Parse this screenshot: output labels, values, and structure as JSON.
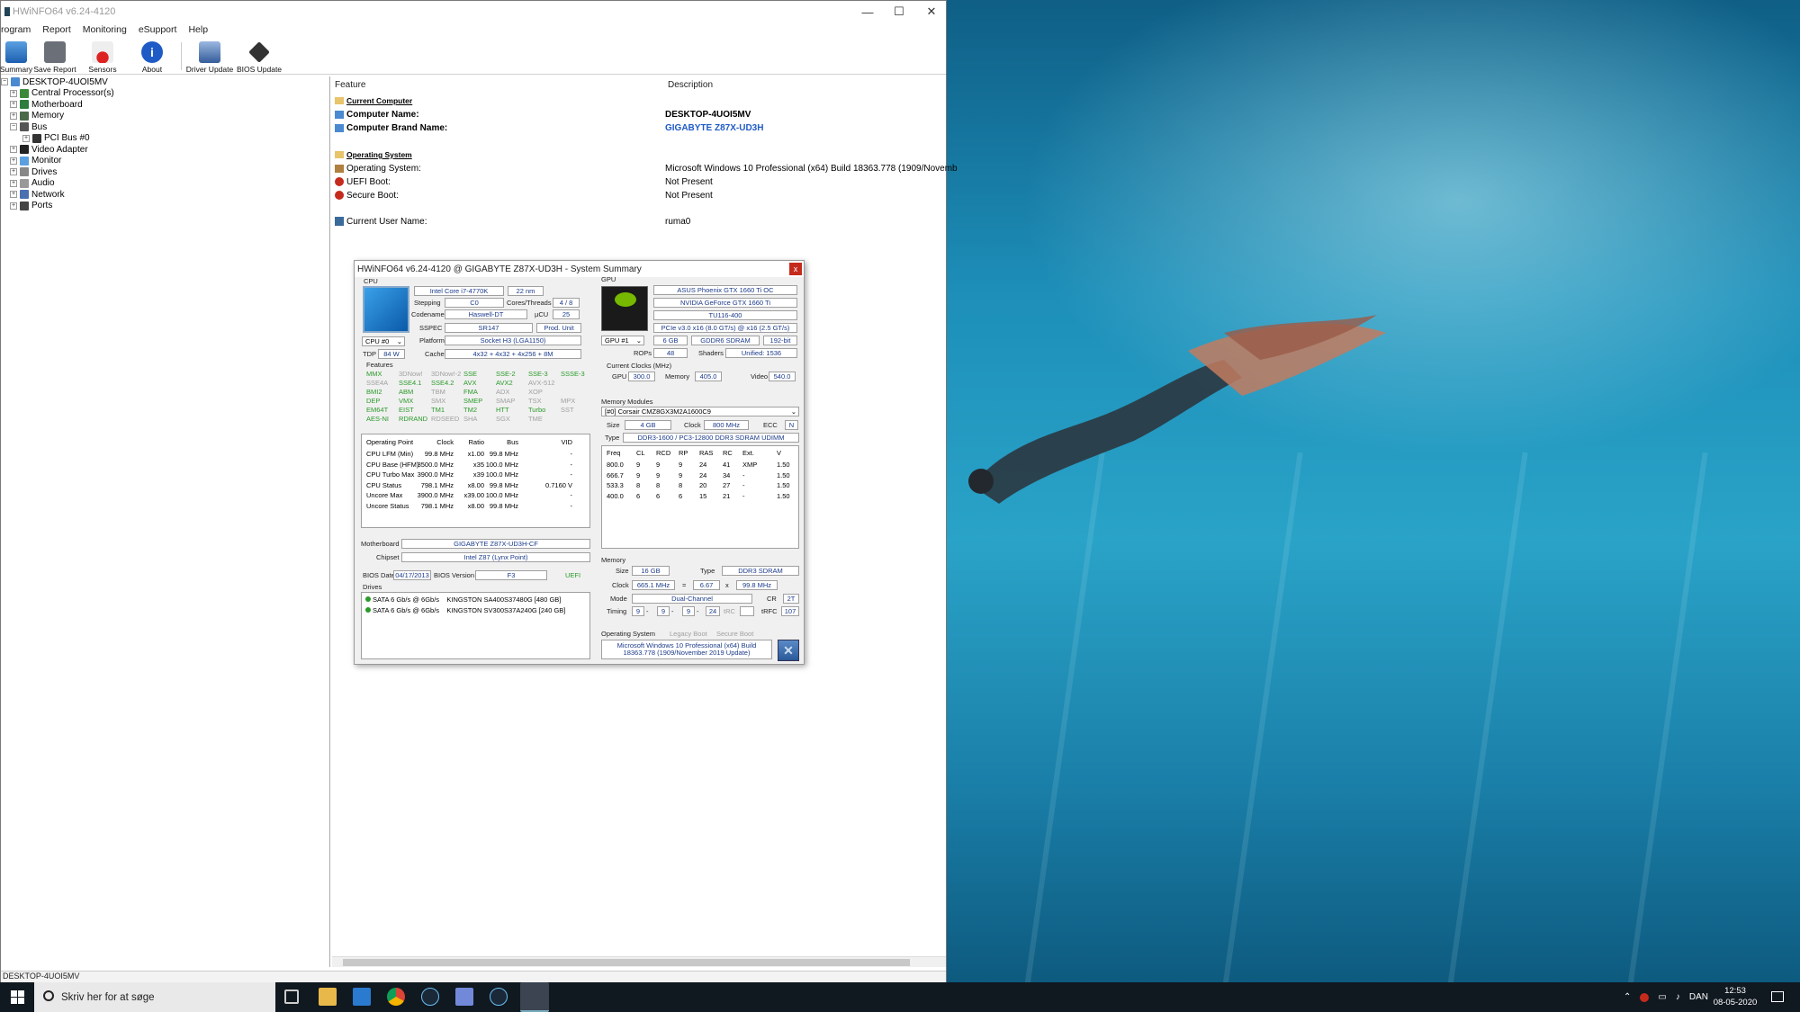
{
  "window": {
    "title": "HWiNFO64 v6.24-4120",
    "controls": {
      "minimize": "—",
      "maximize": "☐",
      "close": "✕"
    }
  },
  "menu": [
    "rogram",
    "Report",
    "Monitoring",
    "eSupport",
    "Help"
  ],
  "toolbar": [
    "Summary",
    "Save Report",
    "Sensors",
    "About",
    "Driver Update",
    "BIOS Update"
  ],
  "tree": {
    "root": "DESKTOP-4UOI5MV",
    "items": [
      "Central Processor(s)",
      "Motherboard",
      "Memory",
      "Bus",
      "PCI Bus #0",
      "Video Adapter",
      "Monitor",
      "Drives",
      "Audio",
      "Network",
      "Ports"
    ]
  },
  "detail": {
    "col_feature": "Feature",
    "col_description": "Description",
    "current_computer": "Current Computer",
    "computer_name_label": "Computer Name:",
    "computer_name": "DESKTOP-4UOI5MV",
    "brand_label": "Computer Brand Name:",
    "brand": "GIGABYTE Z87X-UD3H",
    "operating_system": "Operating System",
    "os_label": "Operating System:",
    "os": "Microsoft Windows 10 Professional (x64) Build 18363.778 (1909/Novemb",
    "uefi_label": "UEFI Boot:",
    "uefi": "Not Present",
    "secure_label": "Secure Boot:",
    "secure": "Not Present",
    "user_label": "Current User Name:",
    "user": "ruma0"
  },
  "status": "DESKTOP-4UOI5MV",
  "summary": {
    "title": "HWiNFO64 v6.24-4120 @ GIGABYTE Z87X-UD3H - System Summary",
    "close": "x",
    "cpu_label": "CPU",
    "cpu_name": "Intel Core i7-4770K",
    "cpu_nm": "22 nm",
    "stepping_label": "Stepping",
    "stepping": "C0",
    "cores_label": "Cores/Threads",
    "cores": "4 / 8",
    "codename_label": "Codename",
    "codename": "Haswell-DT",
    "ucu_label": "µCU",
    "ucu": "25",
    "sspec_label": "SSPEC",
    "sspec": "SR147",
    "prod": "Prod. Unit",
    "cpu_sel": "CPU #0",
    "platform_label": "Platform",
    "platform": "Socket H3 (LGA1150)",
    "tdp_label": "TDP",
    "tdp": "84 W",
    "cache_label": "Cache",
    "cache": "4x32 + 4x32 + 4x256 + 8M",
    "features_label": "Features",
    "features": [
      [
        "MMX",
        "3DNow!",
        "3DNow!-2",
        "SSE",
        "SSE-2",
        "SSE-3",
        "SSSE-3"
      ],
      [
        "SSE4A",
        "SSE4.1",
        "SSE4.2",
        "AVX",
        "AVX2",
        "AVX-512",
        ""
      ],
      [
        "BMI2",
        "ABM",
        "TBM",
        "FMA",
        "ADX",
        "XOP",
        ""
      ],
      [
        "DEP",
        "VMX",
        "SMX",
        "SMEP",
        "SMAP",
        "TSX",
        "MPX"
      ],
      [
        "EM64T",
        "EIST",
        "TM1",
        "TM2",
        "HTT",
        "Turbo",
        "SST"
      ],
      [
        "AES-NI",
        "RDRAND",
        "RDSEED",
        "SHA",
        "SGX",
        "TME",
        ""
      ]
    ],
    "op_headers": [
      "Operating Point",
      "Clock",
      "Ratio",
      "Bus",
      "VID"
    ],
    "op_rows": [
      [
        "CPU LFM (Min)",
        "99.8 MHz",
        "x1.00",
        "99.8 MHz",
        "-"
      ],
      [
        "CPU Base (HFM)",
        "3500.0 MHz",
        "x35",
        "100.0 MHz",
        "-"
      ],
      [
        "CPU Turbo Max",
        "3900.0 MHz",
        "x39",
        "100.0 MHz",
        "-"
      ],
      [
        "CPU Status",
        "798.1 MHz",
        "x8.00",
        "99.8 MHz",
        "0.7160 V"
      ],
      [
        "Uncore Max",
        "3900.0 MHz",
        "x39.00",
        "100.0 MHz",
        "-"
      ],
      [
        "Uncore Status",
        "798.1 MHz",
        "x8.00",
        "99.8 MHz",
        "-"
      ]
    ],
    "mobo_label": "Motherboard",
    "mobo": "GIGABYTE Z87X-UD3H-CF",
    "chipset_label": "Chipset",
    "chipset": "Intel Z87 (Lynx Point)",
    "bios_date_label": "BIOS Date",
    "bios_date": "04/17/2013",
    "bios_ver_label": "BIOS Version",
    "bios_ver": "F3",
    "uefi": "UEFI",
    "drives_label": "Drives",
    "drives": [
      [
        "SATA 6 Gb/s @ 6Gb/s",
        "KINGSTON SA400S37480G [480 GB]"
      ],
      [
        "SATA 6 Gb/s @ 6Gb/s",
        "KINGSTON SV300S37A240G [240 GB]"
      ]
    ],
    "gpu_label": "GPU",
    "gpu_card": "ASUS Phoenix GTX 1660 Ti OC",
    "gpu_name": "NVIDIA GeForce GTX 1660 Ti",
    "gpu_chip": "TU116-400",
    "gpu_pcie": "PCIe v3.0 x16 (8.0 GT/s) @ x16 (2.5 GT/s)",
    "gpu_sel": "GPU #1",
    "vram": "6 GB",
    "vram_type": "GDDR6 SDRAM",
    "bus_width": "192-bit",
    "rops_label": "ROPs",
    "rops": "48",
    "shaders_label": "Shaders",
    "shaders": "Unified: 1536",
    "clocks_label": "Current Clocks (MHz)",
    "gpu_clk_label": "GPU",
    "gpu_clk": "300.0",
    "mem_clk_label": "Memory",
    "mem_clk": "405.0",
    "video_clk_label": "Video",
    "video_clk": "540.0",
    "memmod_label": "Memory Modules",
    "memmod_sel": "[#0] Corsair CMZ8GX3M2A1600C9",
    "mm_size_label": "Size",
    "mm_size": "4 GB",
    "mm_clock_label": "Clock",
    "mm_clock": "800 MHz",
    "ecc_label": "ECC",
    "ecc": "N",
    "mm_type_label": "Type",
    "mm_type": "DDR3-1600 / PC3-12800 DDR3 SDRAM UDIMM",
    "timing_headers": [
      "Freq",
      "CL",
      "RCD",
      "RP",
      "RAS",
      "RC",
      "Ext.",
      "V"
    ],
    "timing_rows": [
      [
        "800.0",
        "9",
        "9",
        "9",
        "24",
        "41",
        "XMP",
        "1.50"
      ],
      [
        "666.7",
        "9",
        "9",
        "9",
        "24",
        "34",
        "-",
        "1.50"
      ],
      [
        "533.3",
        "8",
        "8",
        "8",
        "20",
        "27",
        "-",
        "1.50"
      ],
      [
        "400.0",
        "6",
        "6",
        "6",
        "15",
        "21",
        "-",
        "1.50"
      ]
    ],
    "memory_label": "Memory",
    "mem_size_label": "Size",
    "mem_size": "16 GB",
    "mem_type_label": "Type",
    "mem_type": "DDR3 SDRAM",
    "mem_clock_label": "Clock",
    "mem_clock": "665.1 MHz",
    "eq": "=",
    "mult": "6.67",
    "x": "x",
    "base": "99.8 MHz",
    "mode_label": "Mode",
    "mode": "Dual-Channel",
    "cr_label": "CR",
    "cr": "2T",
    "timing_label": "Timing",
    "t1": "9",
    "t2": "9",
    "t3": "9",
    "t4": "24",
    "trc_label": "tRC",
    "trfc_label": "tRFC",
    "trfc": "107",
    "os_label": "Operating System",
    "legacy": "Legacy Boot",
    "secure": "Secure Boot",
    "os_text": "Microsoft Windows 10 Professional (x64) Build 18363.778 (1909/November 2019 Update)"
  },
  "taskbar": {
    "search": "Skriv her for at søge",
    "lang": "DAN",
    "time": "12:53",
    "date": "08-05-2020"
  }
}
